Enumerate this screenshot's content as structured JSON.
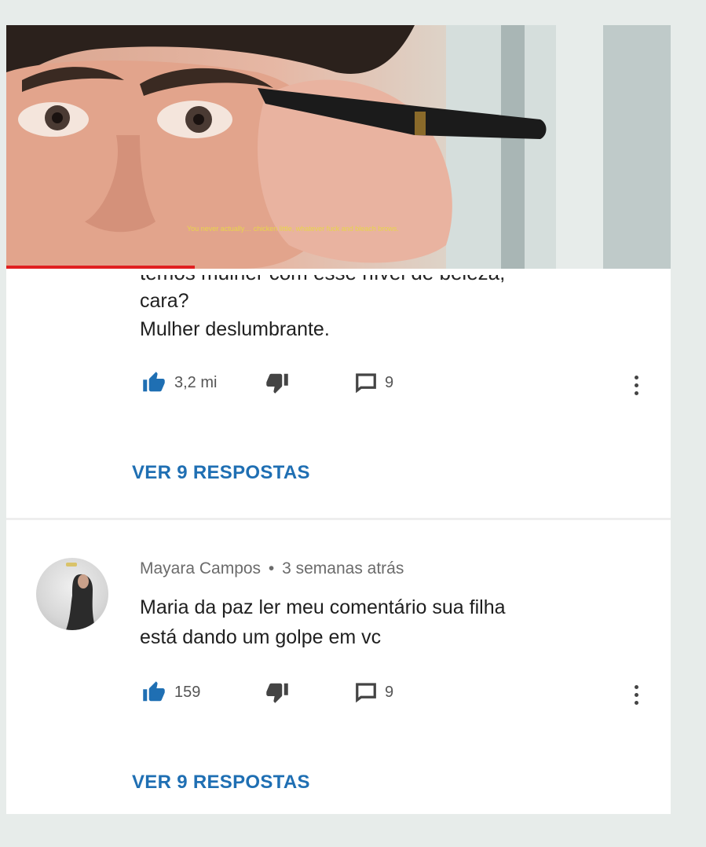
{
  "video": {
    "subtitle": "You never actually… chicken little, whatever fuck and bleach brows."
  },
  "comment1": {
    "text_cut": "temos mulher com esse nível de beleza,",
    "text_line2": "cara?",
    "text_line3": "Mulher deslumbrante.",
    "likes": "3,2 mi",
    "replies_count": "9",
    "view_replies": "VER 9 RESPOSTAS"
  },
  "comment2": {
    "author": "Mayara Campos",
    "separator": "•",
    "time": "3 semanas atrás",
    "text_line1": "Maria da paz ler meu comentário sua filha",
    "text_line2": "está dando um golpe em vc",
    "likes": "159",
    "replies_count": "9",
    "view_replies": "VER 9 RESPOSTAS"
  },
  "icons": {
    "like": "thumb-up-icon",
    "dislike": "thumb-down-icon",
    "reply": "comment-icon",
    "more": "more-vert-icon"
  },
  "colors": {
    "accent": "#1f6fb3",
    "progress": "#e02020"
  }
}
